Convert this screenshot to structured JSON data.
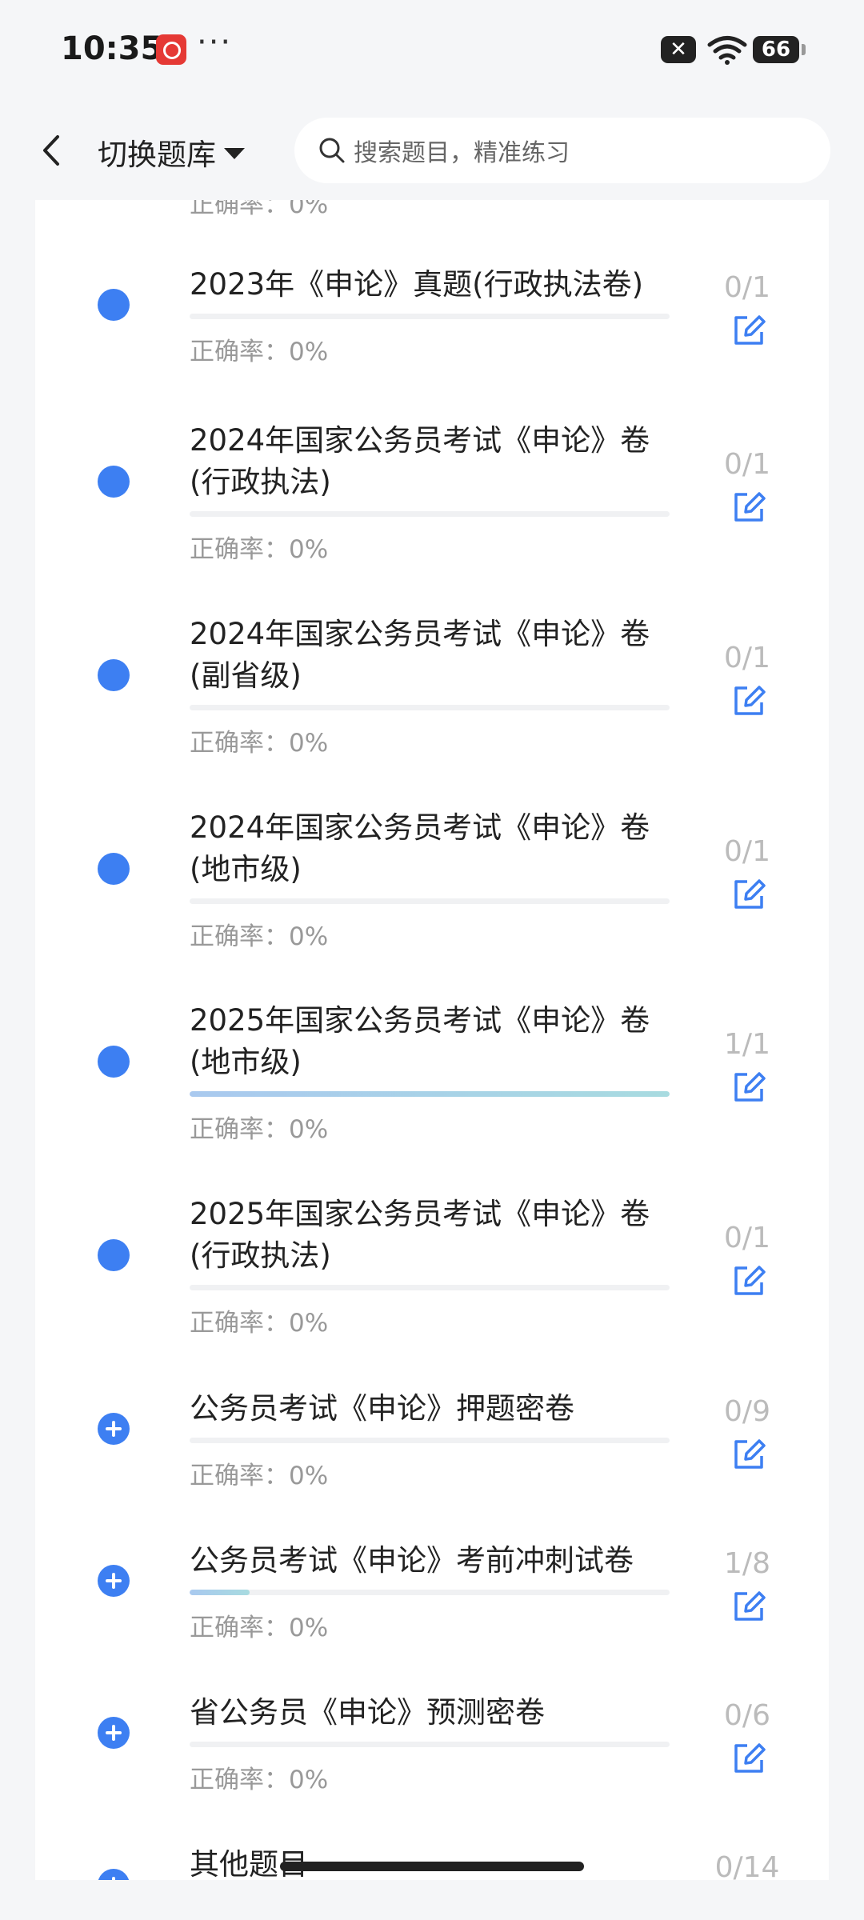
{
  "status": {
    "time": "10:35",
    "more": "···",
    "battery": "66"
  },
  "header": {
    "switch_label": "切换题库",
    "search_placeholder": "搜索题目，精准练习"
  },
  "partial_accuracy": "正确率：0%",
  "items": [
    {
      "title": "2023年《申论》真题(行政执法卷)",
      "count": "0/1",
      "accuracy": "正确率：0%",
      "progress": 0,
      "expandable": false
    },
    {
      "title": "2024年国家公务员考试《申论》卷(行政执法)",
      "count": "0/1",
      "accuracy": "正确率：0%",
      "progress": 0,
      "expandable": false
    },
    {
      "title": "2024年国家公务员考试《申论》卷(副省级)",
      "count": "0/1",
      "accuracy": "正确率：0%",
      "progress": 0,
      "expandable": false
    },
    {
      "title": "2024年国家公务员考试《申论》卷(地市级)",
      "count": "0/1",
      "accuracy": "正确率：0%",
      "progress": 0,
      "expandable": false
    },
    {
      "title": "2025年国家公务员考试《申论》卷(地市级)",
      "count": "1/1",
      "accuracy": "正确率：0%",
      "progress": 1,
      "expandable": false
    },
    {
      "title": "2025年国家公务员考试《申论》卷(行政执法)",
      "count": "0/1",
      "accuracy": "正确率：0%",
      "progress": 0,
      "expandable": false
    },
    {
      "title": "公务员考试《申论》押题密卷",
      "count": "0/9",
      "accuracy": "正确率：0%",
      "progress": 0,
      "expandable": true
    },
    {
      "title": "公务员考试《申论》考前冲刺试卷",
      "count": "1/8",
      "accuracy": "正确率：0%",
      "progress": 0.125,
      "expandable": true
    },
    {
      "title": "省公务员《申论》预测密卷",
      "count": "0/6",
      "accuracy": "正确率：0%",
      "progress": 0,
      "expandable": true
    },
    {
      "title": "其他题目",
      "count": "0/14",
      "accuracy": "",
      "progress": 0,
      "expandable": true
    }
  ]
}
